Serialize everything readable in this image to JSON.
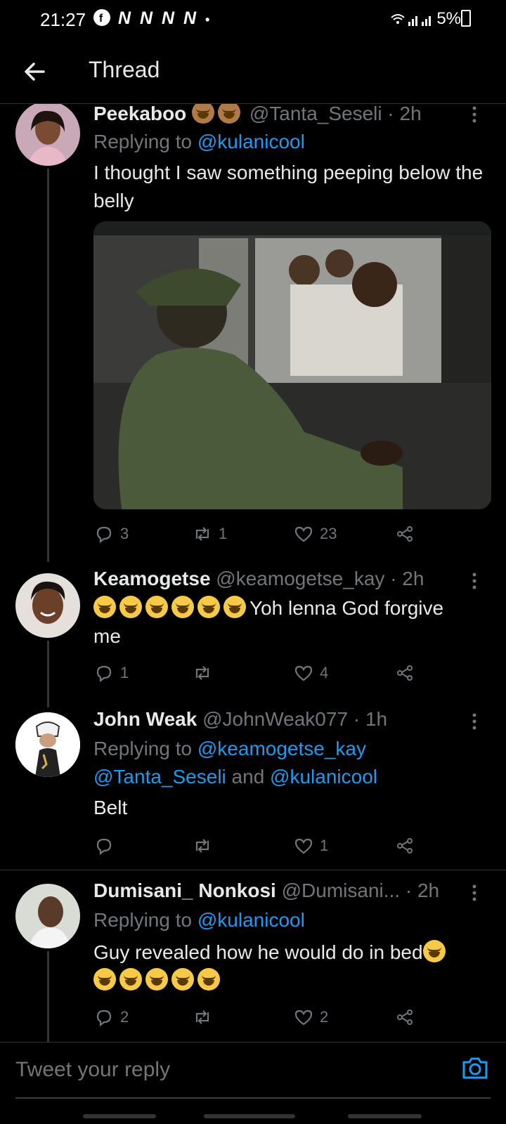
{
  "status_bar": {
    "time": "21:27",
    "notification_icons": "N N N N",
    "battery": "5%"
  },
  "header": {
    "title": "Thread"
  },
  "tweets": [
    {
      "name": "Peekaboo",
      "handle": "@Tanta_Seseli",
      "time": "· 2h",
      "replying_label": "Replying to",
      "replying_to": "@kulanicool",
      "text": "I thought I saw something peeping below the belly",
      "replies": "3",
      "retweets": "1",
      "likes": "23"
    },
    {
      "name": "Keamogetse",
      "handle": "@keamogetse_kay",
      "time": "· 2h",
      "text": "Yoh lenna God forgive me",
      "replies": "1",
      "retweets": "",
      "likes": "4"
    },
    {
      "name": "John Weak",
      "handle": "@JohnWeak077",
      "time": "· 1h",
      "replying_label": "Replying to",
      "replying_to": "@keamogetse_kay",
      "replying_to_2": "@Tanta_Seseli",
      "and_label": "and",
      "replying_to_3": "@kulanicool",
      "text": "Belt",
      "replies": "",
      "retweets": "",
      "likes": "1"
    },
    {
      "name": "Dumisani_ Nonkosi",
      "handle": "@Dumisani...",
      "time": "· 2h",
      "replying_label": "Replying to",
      "replying_to": "@kulanicool",
      "text": "Guy revealed how he would do in bed",
      "replies": "2",
      "retweets": "",
      "likes": "2"
    }
  ],
  "compose": {
    "placeholder": "Tweet your reply"
  },
  "colors": {
    "background": "#000000",
    "link": "#1d9bf0",
    "muted": "#71767b",
    "text": "#e7e9ea"
  },
  "icons": [
    "back-arrow-icon",
    "more-icon",
    "reply-icon",
    "retweet-icon",
    "like-icon",
    "share-icon",
    "camera-icon"
  ]
}
